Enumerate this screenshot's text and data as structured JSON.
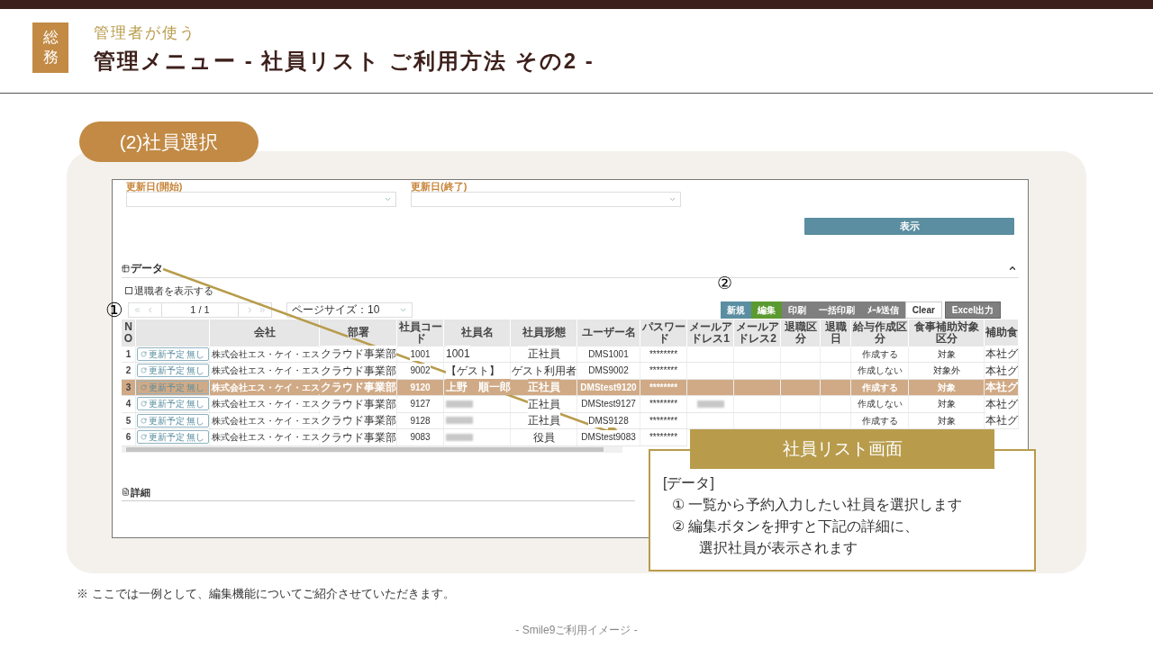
{
  "header": {
    "badge": "総務",
    "subtitle": "管理者が使う",
    "title": "管理メニュー - 社員リスト ご利用方法 その2 -"
  },
  "section_pill": "(2)社員選択",
  "screenshot": {
    "filters": [
      {
        "label": "更新日(開始)"
      },
      {
        "label": "更新日(終了)"
      }
    ],
    "show_button": "表示",
    "data_section": {
      "title": "データ",
      "expanded": true
    },
    "retired_checkbox": {
      "label": "退職者を表示する",
      "checked": false
    },
    "pager": {
      "page": "1 / 1",
      "page_size": "ページサイズ：10"
    },
    "toolbar": [
      {
        "label": "新規",
        "kind": "primary"
      },
      {
        "label": "編集",
        "kind": "success"
      },
      {
        "label": "印刷",
        "kind": "default"
      },
      {
        "label": "一括印刷",
        "kind": "default"
      },
      {
        "label": "ﾒｰﾙ送信",
        "kind": "default"
      },
      {
        "label": "Clear",
        "kind": "light"
      },
      {
        "label": "Excel出力",
        "kind": "dark"
      }
    ],
    "table": {
      "columns": [
        "NO",
        "",
        "会社",
        "部署",
        "社員コード",
        "社員名",
        "社員形態",
        "ユーザー名",
        "パスワード",
        "メールアドレス1",
        "メールアドレス2",
        "退職区分",
        "退職日",
        "給与作成区分",
        "食事補助対象区分",
        "補助食"
      ],
      "rows": [
        {
          "selected": false,
          "cells": [
            "1",
            {
              "kind": "button",
              "text": "更新予定 無し"
            },
            "株式会社エス・ケイ・エス",
            "クラウド事業部",
            "1001",
            "1001",
            "正社員",
            "DMS1001",
            "********",
            null,
            null,
            null,
            null,
            "作成する",
            "対象",
            "本社グ"
          ]
        },
        {
          "selected": false,
          "cells": [
            "2",
            {
              "kind": "button",
              "text": "更新予定 無し"
            },
            "株式会社エス・ケイ・エス",
            "クラウド事業部",
            "9002",
            "【ゲスト】",
            "ゲスト利用者",
            "DMS9002",
            "********",
            null,
            null,
            null,
            null,
            "作成しない",
            "対象外",
            "本社グ"
          ]
        },
        {
          "selected": true,
          "cells": [
            "3",
            {
              "kind": "button",
              "text": "更新予定 無し"
            },
            "株式会社エス・ケイ・エス",
            "クラウド事業部",
            "9120",
            "上野　順一郎",
            "正社員",
            "DMStest9120",
            "********",
            null,
            null,
            null,
            null,
            "作成する",
            "対象",
            "本社グ"
          ]
        },
        {
          "selected": false,
          "cells": [
            "4",
            {
              "kind": "button",
              "text": "更新予定 無し"
            },
            "株式会社エス・ケイ・エス",
            "クラウド事業部",
            "9127",
            {
              "kind": "blurred"
            },
            "正社員",
            "DMStest9127",
            "********",
            {
              "kind": "blurred"
            },
            null,
            null,
            null,
            "作成しない",
            "対象",
            "本社グ"
          ]
        },
        {
          "selected": false,
          "cells": [
            "5",
            {
              "kind": "button",
              "text": "更新予定 無し"
            },
            "株式会社エス・ケイ・エス",
            "クラウド事業部",
            "9128",
            {
              "kind": "blurred"
            },
            "正社員",
            "DMS9128",
            "********",
            null,
            null,
            null,
            null,
            "作成する",
            "対象",
            "本社グ"
          ]
        },
        {
          "selected": false,
          "cells": [
            "6",
            {
              "kind": "button",
              "text": "更新予定 無し"
            },
            "株式会社エス・ケイ・エス",
            "クラウド事業部",
            "9083",
            {
              "kind": "blurred"
            },
            "役員",
            "DMStest9083",
            "********"
          ]
        }
      ]
    },
    "detail_section": {
      "title": "詳細"
    }
  },
  "markers": [
    "①",
    "②"
  ],
  "callout": {
    "title": "社員リスト画面",
    "heading": "[データ]",
    "lines": [
      {
        "mark": "①",
        "text": "一覧から予約入力したい社員を選択します"
      },
      {
        "mark": "②",
        "text": "編集ボタンを押すと下記の詳細に、"
      },
      {
        "text": "選択社員が表示されます"
      }
    ]
  },
  "footnote": "※ ここでは一例として、編集機能についてご紹介させていただきます。",
  "footer": "- Smile9ご利用イメージ -"
}
